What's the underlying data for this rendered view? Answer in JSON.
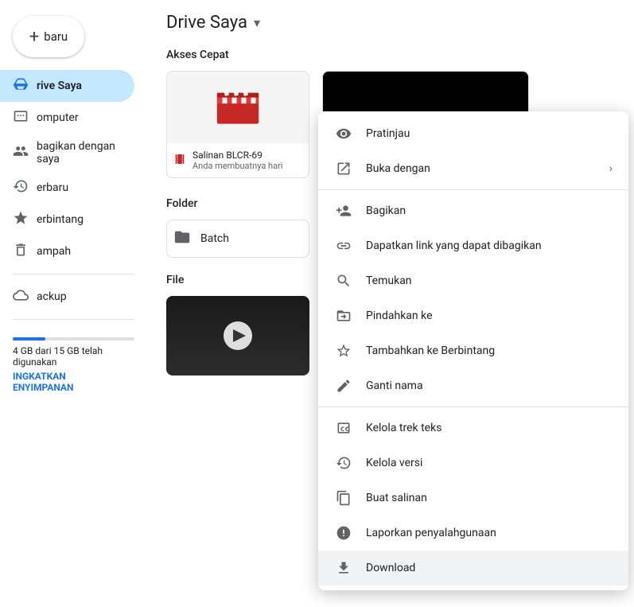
{
  "sidebar": {
    "new_button": "baru",
    "items": [
      {
        "id": "drive-saya",
        "label": "rive Saya",
        "active": true
      },
      {
        "id": "komputer",
        "label": "omputer",
        "active": false
      },
      {
        "id": "dibagikan",
        "label": "bagikan dengan saya",
        "active": false
      },
      {
        "id": "terbaru",
        "label": "erbaru",
        "active": false
      },
      {
        "id": "berbintang",
        "label": "erbintang",
        "active": false
      },
      {
        "id": "sampah",
        "label": "ampah",
        "active": false
      },
      {
        "id": "backup",
        "label": "ackup",
        "active": false
      }
    ],
    "storage_label": "4 GB dari 15 GB telah digunakan",
    "upgrade_label": "INGKATKAN\nENYIMPANAN"
  },
  "main": {
    "title": "Drive Saya",
    "quick_access_label": "Akses Cepat",
    "folder_label": "Folder",
    "file_label": "File",
    "file_card": {
      "name": "Salinan BLCR-69",
      "date": "Anda membuatnya hari"
    },
    "folder": {
      "name": "Batch"
    }
  },
  "context_menu": {
    "items": [
      {
        "id": "pratinjau",
        "label": "Pratinjau",
        "icon": "eye",
        "has_arrow": false,
        "divider_after": false
      },
      {
        "id": "buka-dengan",
        "label": "Buka dengan",
        "icon": "open-with",
        "has_arrow": true,
        "divider_after": false
      },
      {
        "id": "bagikan",
        "label": "Bagikan",
        "icon": "person-add",
        "has_arrow": false,
        "divider_after": false
      },
      {
        "id": "dapatkan-link",
        "label": "Dapatkan link yang dapat dibagikan",
        "icon": "link",
        "has_arrow": false,
        "divider_after": false
      },
      {
        "id": "temukan",
        "label": "Temukan",
        "icon": "search",
        "has_arrow": false,
        "divider_after": false
      },
      {
        "id": "pindahkan",
        "label": "Pindahkan ke",
        "icon": "folder-move",
        "has_arrow": false,
        "divider_after": false
      },
      {
        "id": "berbintang",
        "label": "Tambahkan ke Berbintang",
        "icon": "star",
        "has_arrow": false,
        "divider_after": false
      },
      {
        "id": "ganti-nama",
        "label": "Ganti nama",
        "icon": "edit",
        "has_arrow": false,
        "divider_after": true
      },
      {
        "id": "kelola-trek",
        "label": "Kelola trek teks",
        "icon": "cc",
        "has_arrow": false,
        "divider_after": false
      },
      {
        "id": "kelola-versi",
        "label": "Kelola versi",
        "icon": "history",
        "has_arrow": false,
        "divider_after": false
      },
      {
        "id": "buat-salinan",
        "label": "Buat salinan",
        "icon": "copy",
        "has_arrow": false,
        "divider_after": false
      },
      {
        "id": "laporkan",
        "label": "Laporkan penyalahgunaan",
        "icon": "report",
        "has_arrow": false,
        "divider_after": false
      },
      {
        "id": "download",
        "label": "Download",
        "icon": "download",
        "has_arrow": false,
        "divider_after": false,
        "active": true
      }
    ]
  }
}
